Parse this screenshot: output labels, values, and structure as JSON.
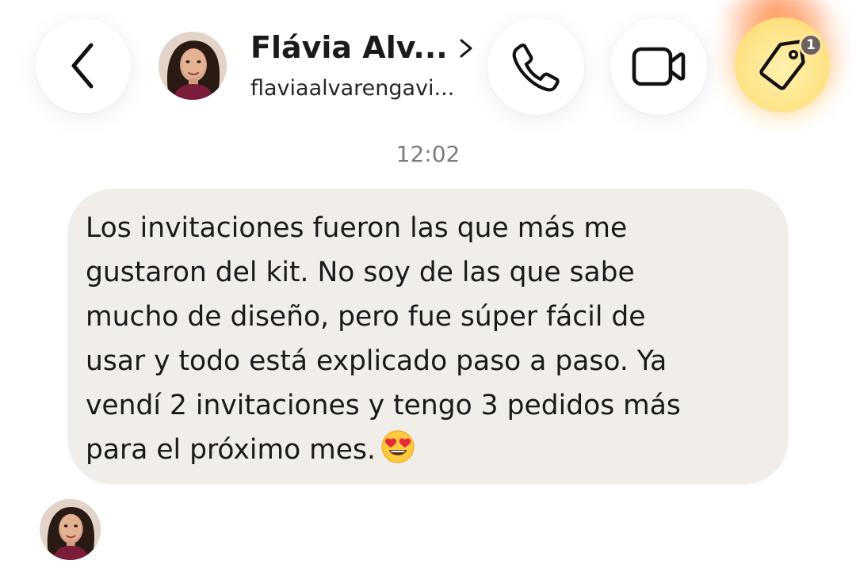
{
  "header": {
    "contact_name": "Flávia Alv...",
    "contact_handle": "flaviaalvarengavi...",
    "tag_badge_count": "1",
    "icons": {
      "back": "chevron-left-icon",
      "call": "phone-icon",
      "video": "video-camera-icon",
      "tag": "tag-icon",
      "profile_chevron": "chevron-right-icon"
    }
  },
  "thread": {
    "timestamp": "12:02",
    "message": {
      "text": "Los invitaciones fueron las que más me\ngustaron del kit. No soy de las que sabe\nmucho de diseño, pero fue súper fácil de\nusar y todo está explicado paso a paso. Ya\nvendí 2 invitaciones y tengo 3 pedidos más\npara el próximo mes.",
      "emoji": "heart-eyes-emoji"
    }
  },
  "colors": {
    "bubble_background": "#f1eeea",
    "tag_button_yellow": "#ffe48a",
    "timestamp_gray": "#7b7b7b",
    "badge_gray": "#6b6260"
  }
}
